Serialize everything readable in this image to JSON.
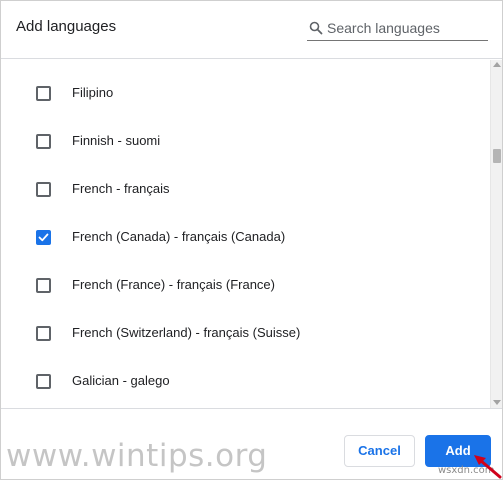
{
  "dialog": {
    "title": "Add languages",
    "search": {
      "placeholder": "Search languages",
      "value": ""
    }
  },
  "languages": [
    {
      "label": "Filipino",
      "checked": false
    },
    {
      "label": "Finnish - suomi",
      "checked": false
    },
    {
      "label": "French - français",
      "checked": false
    },
    {
      "label": "French (Canada) - français (Canada)",
      "checked": true
    },
    {
      "label": "French (France) - français (France)",
      "checked": false
    },
    {
      "label": "French (Switzerland) - français (Suisse)",
      "checked": false
    },
    {
      "label": "Galician - galego",
      "checked": false
    }
  ],
  "footer": {
    "cancel_label": "Cancel",
    "add_label": "Add"
  },
  "watermark": {
    "text": "www.wintips.org",
    "corner_text": "wsxdn.com"
  },
  "colors": {
    "accent": "#1a73e8",
    "checkbox_border": "#5f6368",
    "divider": "#dadce0",
    "pointer_arrow": "#d0021b"
  },
  "icons": {
    "search": "search-icon",
    "check": "checkmark-icon",
    "pointer": "arrow-pointer-icon"
  }
}
